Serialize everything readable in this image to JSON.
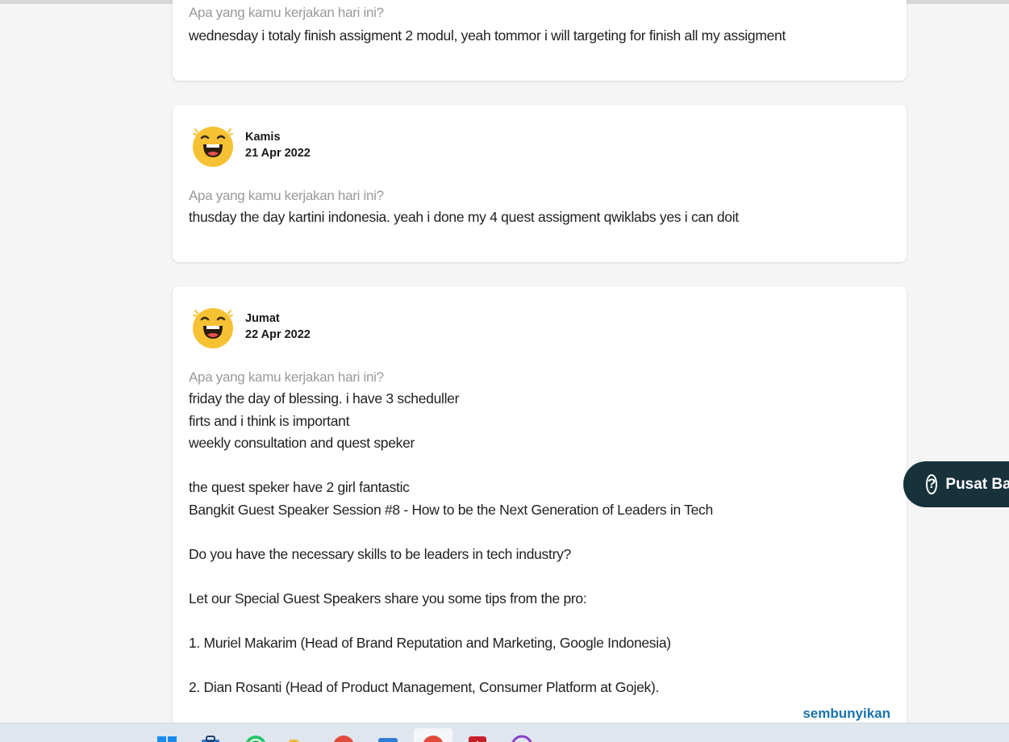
{
  "entries": [
    {
      "question": "Apa yang kamu kerjakan hari ini?",
      "answer": "wednesday i totaly finish assigment 2 modul, yeah tommor i will targeting for finish all my assigment"
    },
    {
      "day": "Kamis",
      "date": "21 Apr 2022",
      "mood_icon": "laughing-face-icon",
      "question": "Apa yang kamu kerjakan hari ini?",
      "answer": "thusday the day kartini indonesia. yeah i done my 4 quest assigment qwiklabs yes i can doit"
    },
    {
      "day": "Jumat",
      "date": "22 Apr 2022",
      "mood_icon": "laughing-face-icon",
      "question": "Apa yang kamu kerjakan hari ini?",
      "answer": "friday the day of blessing. i have 3 scheduller\nfirts and i think is important\nweekly consultation and quest speker\n\nthe quest speker have 2 girl fantastic\nBangkit Guest Speaker Session #8 - How to be the Next Generation of Leaders in Tech\n\nDo you have the necessary skills to be leaders in tech industry?\n\nLet our Special Guest Speakers share you some tips from the pro:\n\n1. Muriel Makarim (Head of Brand Reputation and Marketing, Google Indonesia)\n\n2. Dian Rosanti (Head of Product Management, Consumer Platform at Gojek).",
      "hide_label": "sembunyikan"
    }
  ],
  "help_button": {
    "label": "Pusat Bantuan",
    "icon": "question-circle-icon"
  },
  "taskbar": {
    "icons": [
      "windows-start-icon",
      "store-icon",
      "whatsapp-icon",
      "file-explorer-icon",
      "chrome-icon",
      "app-icon",
      "chrome-active-icon",
      "acrobat-icon",
      "app-circle-icon"
    ]
  },
  "colors": {
    "accent": "#1a73b0",
    "help_bg": "#17323b",
    "emoji": "#f6c234"
  }
}
